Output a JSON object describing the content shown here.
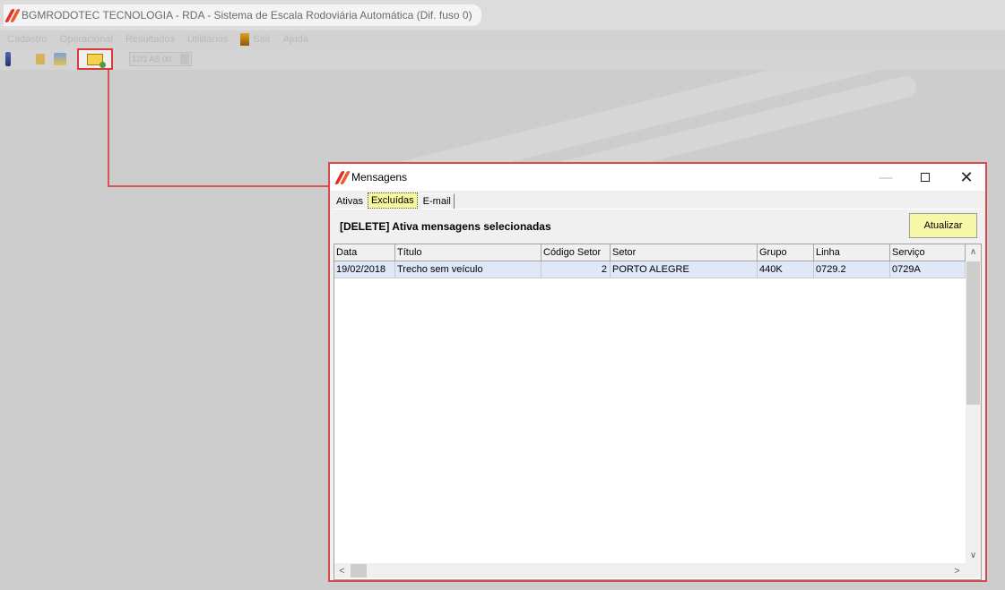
{
  "app": {
    "title": "BGMRODOTEC TECNOLOGIA - RDA - Sistema de Escala Rodoviária Automática (Dif. fuso 0)",
    "menu": [
      "Cadastro",
      "Operacional",
      "Resultados",
      "Utilitários",
      "Sair",
      "Ajuda"
    ],
    "toolbar_combo": "12/1 AS 00"
  },
  "dialog": {
    "title": "Mensagens",
    "minimize_glyph": "—",
    "close_glyph": "✕",
    "tabs": [
      {
        "label": "Ativas",
        "selected": false
      },
      {
        "label": "Excluídas",
        "selected": true
      },
      {
        "label": "E-mail",
        "selected": false
      }
    ],
    "delete_hint": "[DELETE] Ativa mensagens selecionadas",
    "refresh_button": "Atualizar",
    "grid": {
      "columns": [
        "Data",
        "Título",
        "Código Setor",
        "Setor",
        "Grupo",
        "Linha",
        "Serviço"
      ],
      "rows": [
        {
          "data": "19/02/2018",
          "titulo": "Trecho sem veículo",
          "codigo_setor": "2",
          "setor": "PORTO ALEGRE",
          "grupo": "440K",
          "linha": "0729.2",
          "servico": "0729A"
        }
      ]
    },
    "scroll_glyphs": {
      "up": "∧",
      "down": "∨",
      "left": "<",
      "right": ">"
    }
  },
  "colors": {
    "highlight_border": "#d94b4b",
    "selected_tab": "#f7f7a0",
    "button_yellow": "#f7f7a8",
    "selected_row": "#dfe8f6"
  }
}
